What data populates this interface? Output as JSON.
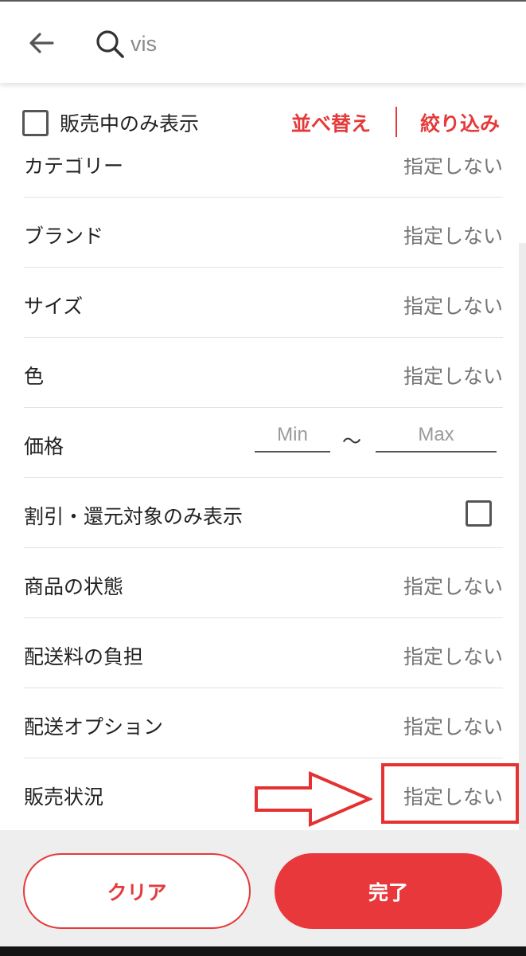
{
  "header": {
    "search_value": "vis"
  },
  "filter_bar": {
    "on_sale_label": "販売中のみ表示",
    "sort_label": "並べ替え",
    "narrow_label": "絞り込み"
  },
  "filters": {
    "category": {
      "label": "カテゴリー",
      "value": "指定しない"
    },
    "brand": {
      "label": "ブランド",
      "value": "指定しない"
    },
    "size": {
      "label": "サイズ",
      "value": "指定しない"
    },
    "color": {
      "label": "色",
      "value": "指定しない"
    },
    "price": {
      "label": "価格",
      "min_placeholder": "Min",
      "separator": "〜",
      "max_placeholder": "Max"
    },
    "discount": {
      "label": "割引・還元対象のみ表示"
    },
    "condition": {
      "label": "商品の状態",
      "value": "指定しない"
    },
    "shipping_fee": {
      "label": "配送料の負担",
      "value": "指定しない"
    },
    "shipping_option": {
      "label": "配送オプション",
      "value": "指定しない"
    },
    "sales_status": {
      "label": "販売状況",
      "value": "指定しない"
    }
  },
  "footer": {
    "clear_label": "クリア",
    "done_label": "完了"
  },
  "colors": {
    "accent": "#e53a3a",
    "annotation": "#e53131"
  },
  "icons": {
    "back": "arrow-left-icon",
    "search": "magnifier-icon",
    "annotation_arrow": "arrow-right-outline-icon"
  }
}
